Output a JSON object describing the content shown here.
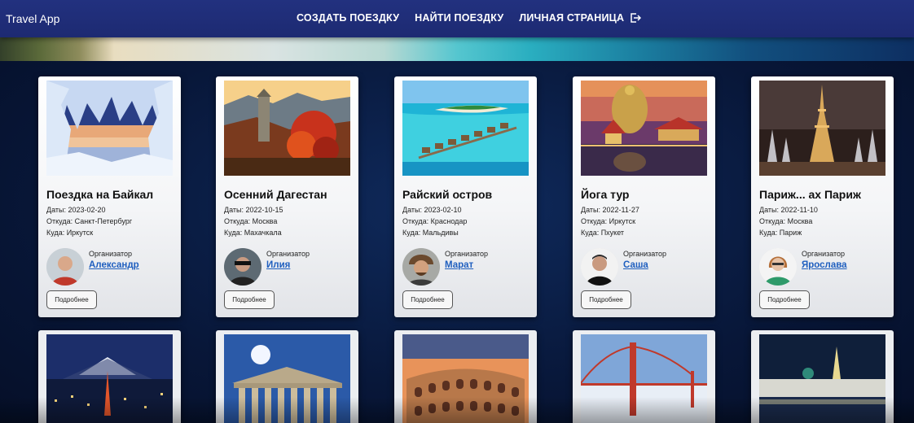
{
  "header": {
    "brand": "Travel App",
    "nav": [
      {
        "label": "СОЗДАТЬ ПОЕЗДКУ"
      },
      {
        "label": "НАЙТИ ПОЕЗДКУ"
      },
      {
        "label": "ЛИЧНАЯ СТРАНИЦА"
      }
    ],
    "logout_icon": "logout-icon"
  },
  "trips": [
    {
      "title": "Поездка на Байкал",
      "dates": "Даты: 2023-02-20",
      "from": "Откуда: Санкт-Петербург",
      "to": "Куда: Иркутск",
      "organizer_label": "Организатор",
      "organizer": "Александр",
      "button": "Подробнее",
      "image": "baikal-ice-cave"
    },
    {
      "title": "Осенний Дагестан",
      "dates": "Даты: 2022-10-15",
      "from": "Откуда: Москва",
      "to": "Куда: Махачкала",
      "organizer_label": "Организатор",
      "organizer": "Илия",
      "button": "Подробнее",
      "image": "dagestan-autumn-tower"
    },
    {
      "title": "Райский остров",
      "dates": "Даты: 2023-02-10",
      "from": "Откуда: Краснодар",
      "to": "Куда: Мальдивы",
      "organizer_label": "Организатор",
      "organizer": "Марат",
      "button": "Подробнее",
      "image": "maldives-water-villas"
    },
    {
      "title": "Йога тур",
      "dates": "Даты: 2022-11-27",
      "from": "Откуда: Иркутск",
      "to": "Куда: Пхукет",
      "organizer_label": "Организатор",
      "organizer": "Саша",
      "button": "Подробнее",
      "image": "thai-temple-statue"
    },
    {
      "title": "Париж... ах Париж",
      "dates": "Даты: 2022-11-10",
      "from": "Откуда: Москва",
      "to": "Куда: Париж",
      "organizer_label": "Организатор",
      "organizer": "Ярослава",
      "button": "Подробнее",
      "image": "eiffel-tower-night"
    }
  ],
  "second_row_images": [
    "tokyo-fuji-night",
    "parthenon",
    "colosseum",
    "golden-gate-bridge",
    "kazan-kremlin-night"
  ],
  "colors": {
    "header": "#1f2c75",
    "link": "#1f5fbf",
    "background": "#0a1a3c"
  }
}
